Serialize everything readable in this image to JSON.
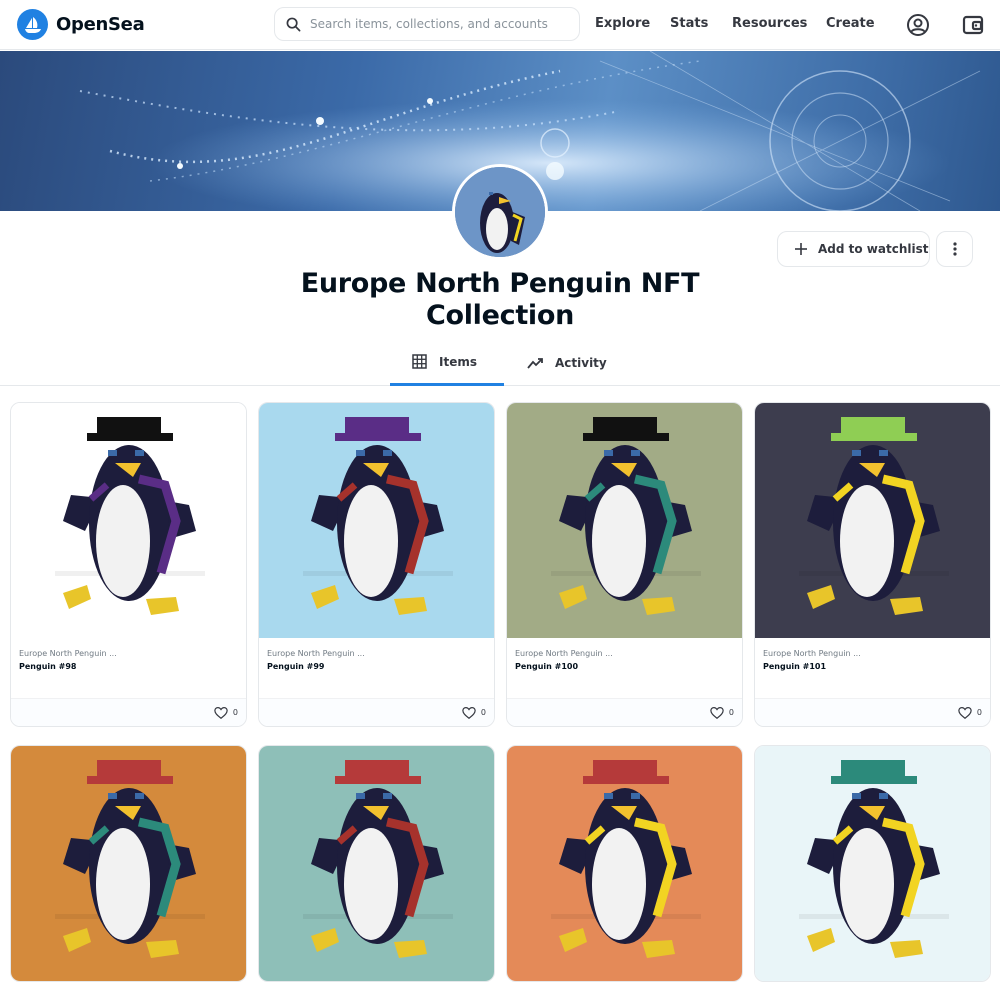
{
  "brand": {
    "name": "OpenSea",
    "accent": "#2081e2"
  },
  "search": {
    "placeholder": "Search items, collections, and accounts"
  },
  "nav": [
    {
      "label": "Explore"
    },
    {
      "label": "Stats"
    },
    {
      "label": "Resources"
    },
    {
      "label": "Create"
    }
  ],
  "collection": {
    "title_line1": "Europe North Penguin NFT",
    "title_line2": "Collection",
    "watchlist_label": "Add to watchlist"
  },
  "tabs": [
    {
      "label": "Items",
      "icon": "grid-icon",
      "active": true
    },
    {
      "label": "Activity",
      "icon": "activity-icon",
      "active": false
    }
  ],
  "items": [
    {
      "collection": "Europe North Penguin ...",
      "name": "Penguin #98",
      "likes": "0",
      "bg": "#ffffff",
      "hat": "#111111",
      "scarf": "#5a2d86"
    },
    {
      "collection": "Europe North Penguin ...",
      "name": "Penguin #99",
      "likes": "0",
      "bg": "#a9d9ee",
      "hat": "#5a2d86",
      "scarf": "#a6322c"
    },
    {
      "collection": "Europe North Penguin ...",
      "name": "Penguin #100",
      "likes": "0",
      "bg": "#a2ab86",
      "hat": "#111111",
      "scarf": "#2c8a7b"
    },
    {
      "collection": "Europe North Penguin ...",
      "name": "Penguin #101",
      "likes": "0",
      "bg": "#3d3d4e",
      "hat": "#8fce54",
      "scarf": "#f2d422"
    },
    {
      "bg": "#d48a3c",
      "hat": "#b53a3a",
      "scarf": "#2c8a7b"
    },
    {
      "bg": "#8ebfb8",
      "hat": "#b53a3a",
      "scarf": "#a6322c"
    },
    {
      "bg": "#e48a58",
      "hat": "#b53a3a",
      "scarf": "#f2d422"
    },
    {
      "bg": "#e9f5f8",
      "hat": "#2c8a7b",
      "scarf": "#f2d422"
    }
  ]
}
